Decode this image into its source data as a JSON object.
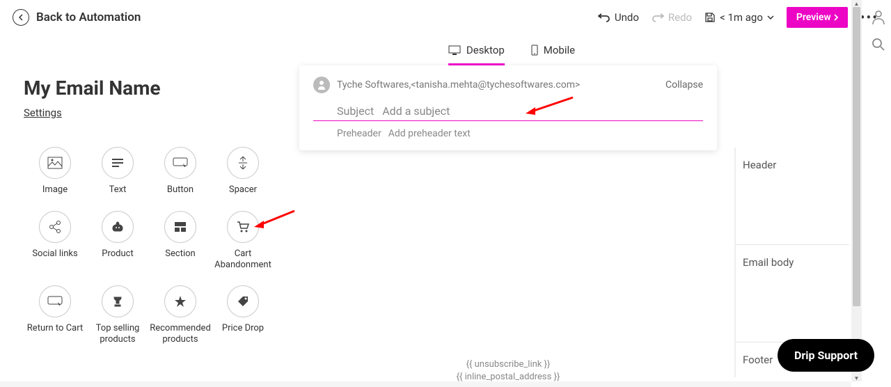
{
  "header": {
    "back_label": "Back to Automation",
    "undo": "Undo",
    "redo": "Redo",
    "saved": "< 1m ago",
    "preview": "Preview"
  },
  "left": {
    "title": "My Email Name",
    "settings": "Settings",
    "blocks": [
      {
        "icon": "image-icon",
        "label": "Image"
      },
      {
        "icon": "text-icon",
        "label": "Text"
      },
      {
        "icon": "button-icon",
        "label": "Button"
      },
      {
        "icon": "spacer-icon",
        "label": "Spacer"
      },
      {
        "icon": "social-links-icon",
        "label": "Social links"
      },
      {
        "icon": "product-icon",
        "label": "Product"
      },
      {
        "icon": "section-icon",
        "label": "Section"
      },
      {
        "icon": "cart-abandonment-icon",
        "label": "Cart Abandonment"
      },
      {
        "icon": "return-to-cart-icon",
        "label": "Return to Cart"
      },
      {
        "icon": "top-selling-icon",
        "label": "Top selling products"
      },
      {
        "icon": "recommended-icon",
        "label": "Recommended products"
      },
      {
        "icon": "price-drop-icon",
        "label": "Price Drop"
      }
    ]
  },
  "tabs": {
    "desktop": "Desktop",
    "mobile": "Mobile"
  },
  "email": {
    "sender": "Tyche Softwares,<tanisha.mehta@tychesoftwares.com>",
    "collapse": "Collapse",
    "subject_label": "Subject",
    "subject_placeholder": "Add a subject",
    "preheader_label": "Preheader",
    "preheader_placeholder": "Add preheader text",
    "tokens": [
      "{{ unsubscribe_link }}",
      "{{ inline_postal_address }}"
    ]
  },
  "sections": {
    "header": "Header",
    "body": "Email body",
    "footer": "Footer"
  },
  "support": "Drip Support"
}
